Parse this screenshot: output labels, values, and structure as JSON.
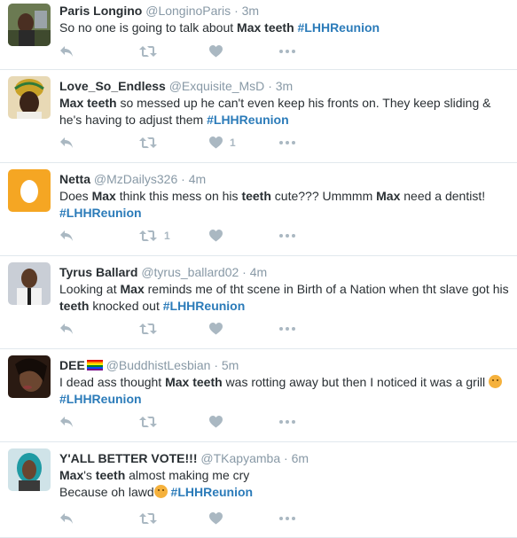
{
  "tweets": [
    {
      "fullname": "Paris Longino",
      "handle": "@LonginoParis",
      "time": "3m",
      "text_parts": [
        "So no one is going to talk about ",
        "Max teeth",
        " ",
        "#LHHReunion"
      ],
      "retweets": "",
      "likes": ""
    },
    {
      "fullname": "Love_So_Endless",
      "handle": "@Exquisite_MsD",
      "time": "3m",
      "text_parts": [
        "Max teeth",
        " so messed up he can't even keep his fronts on. They keep sliding & he's having to adjust them ",
        "#LHHReunion"
      ],
      "retweets": "",
      "likes": "1"
    },
    {
      "fullname": "Netta",
      "handle": "@MzDailys326",
      "time": "4m",
      "text_parts": [
        "Does ",
        "Max",
        " think this mess on his ",
        "teeth",
        " cute??? Ummmm ",
        "Max",
        " need a dentist! ",
        "#LHHReunion"
      ],
      "retweets": "1",
      "likes": ""
    },
    {
      "fullname": "Tyrus Ballard",
      "handle": "@tyrus_ballard02",
      "time": "4m",
      "text_parts": [
        "Looking at ",
        "Max",
        " reminds me of tht scene in Birth of a Nation when tht slave got his ",
        "teeth",
        " knocked out ",
        "#LHHReunion"
      ],
      "retweets": "",
      "likes": ""
    },
    {
      "fullname": "DEE",
      "handle": "@BuddhistLesbian",
      "time": "5m",
      "text_parts": [
        "I dead ass thought ",
        "Max teeth",
        " was rotting away but then I noticed it was a grill ",
        " ",
        "#LHHReunion"
      ],
      "retweets": "",
      "likes": ""
    },
    {
      "fullname": "Y'ALL BETTER VOTE!!!",
      "handle": "@TKapyamba",
      "time": "6m",
      "text_parts": [
        "Max",
        "'s ",
        "teeth",
        " almost making me cry",
        "Because oh lawd",
        " ",
        "#LHHReunion"
      ],
      "retweets": "",
      "likes": ""
    }
  ],
  "dot": "·",
  "icons": {
    "reply": "reply-icon",
    "retweet": "retweet-icon",
    "like": "heart-icon",
    "more": "more-icon"
  },
  "colors": {
    "name": "#292f33",
    "meta": "#8899a6",
    "hashtag": "#2b7bb9",
    "action": "#aab8c2",
    "divider": "#e1e8ed"
  }
}
